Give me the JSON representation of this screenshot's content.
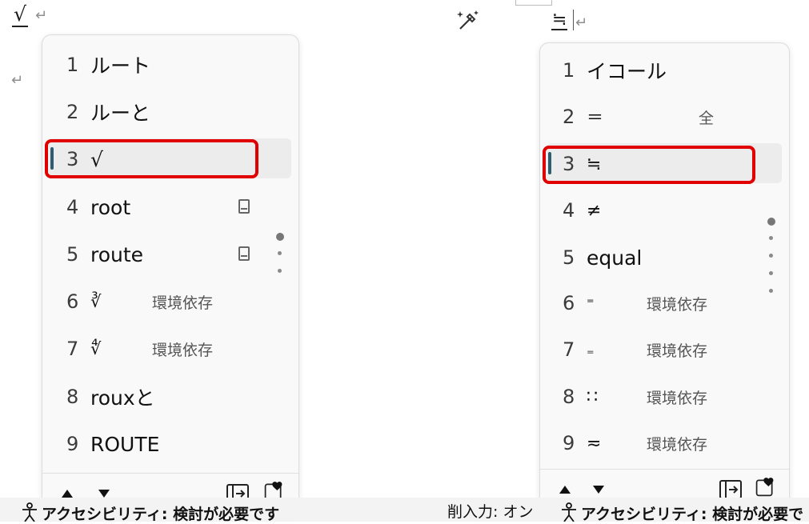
{
  "document": {
    "left_composition": "√",
    "right_composition": "≒",
    "return_mark": "↵"
  },
  "left_panel": {
    "candidates": [
      {
        "num": "1",
        "text": "ルート",
        "note": ""
      },
      {
        "num": "2",
        "text": "ルーと",
        "note": ""
      },
      {
        "num": "3",
        "text": "√",
        "note": ""
      },
      {
        "num": "4",
        "text": "root",
        "note": ""
      },
      {
        "num": "5",
        "text": "route",
        "note": ""
      },
      {
        "num": "6",
        "text": "∛",
        "note": "環境依存"
      },
      {
        "num": "7",
        "text": "∜",
        "note": "環境依存"
      },
      {
        "num": "8",
        "text": "rouxと",
        "note": ""
      },
      {
        "num": "9",
        "text": "ROUTE",
        "note": ""
      }
    ],
    "selected_index": 3,
    "dictionary_icon_rows": [
      4,
      5
    ]
  },
  "right_panel": {
    "candidates": [
      {
        "num": "1",
        "text": "イコール",
        "note": ""
      },
      {
        "num": "2",
        "text": "＝",
        "note": "全"
      },
      {
        "num": "3",
        "text": "≒",
        "note": ""
      },
      {
        "num": "4",
        "text": "≠",
        "note": ""
      },
      {
        "num": "5",
        "text": "equal",
        "note": ""
      },
      {
        "num": "6",
        "text": "⁼",
        "note": "環境依存"
      },
      {
        "num": "7",
        "text": "₌",
        "note": "環境依存"
      },
      {
        "num": "8",
        "text": "∷",
        "note": "環境依存"
      },
      {
        "num": "9",
        "text": "≂",
        "note": "環境依存"
      }
    ],
    "selected_index": 3
  },
  "status_bar": {
    "left_text": "アクセシビリティ: 検討が必要です",
    "right_input": "削入力: オン",
    "right_text": "アクセシビリティ: 検討が必要で"
  },
  "colors": {
    "highlight": "#e00000",
    "selection_indicator": "#2e5d73"
  },
  "icons": {
    "footer_left": [
      "triangle-up-icon",
      "triangle-down-icon"
    ],
    "footer_right": [
      "table-view-icon",
      "favorite-icon"
    ],
    "top": [
      "magic-wand-icon"
    ]
  }
}
